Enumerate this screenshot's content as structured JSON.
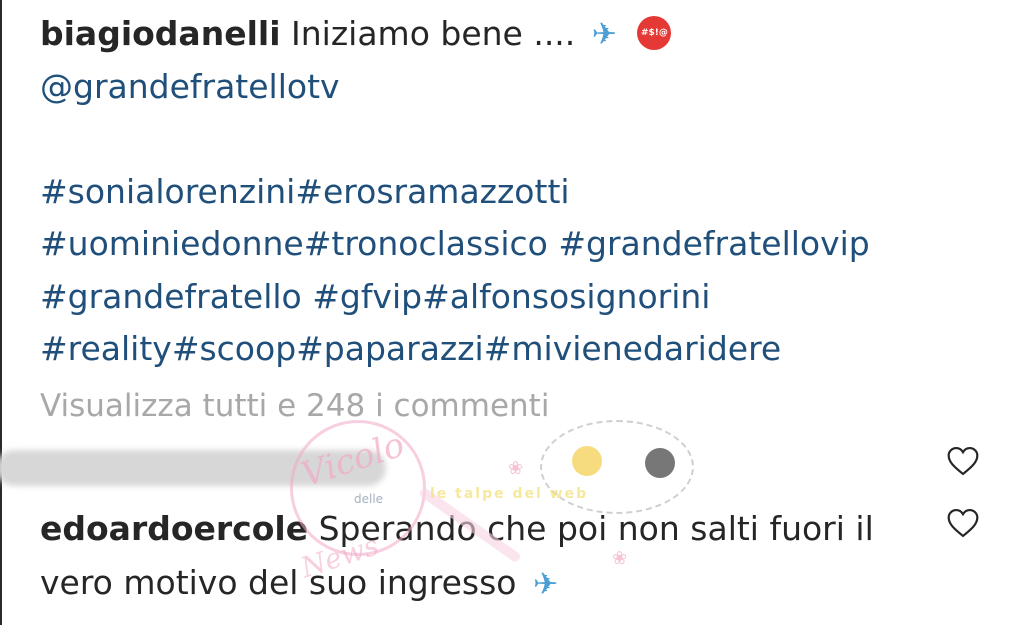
{
  "post": {
    "username": "biagiodanelli",
    "caption_text": "Iniziamo bene ....",
    "mention": "@grandefratellotv",
    "hashtag_lines": [
      "#sonialorenzini#erosramazzotti",
      "#uominiedonne#tronoclassico #grandefratellovip",
      "#grandefratello #gfvip#alfonsosignorini",
      "#reality#scoop#paparazzi#mivienedaridere"
    ],
    "emojis": [
      "airplane-icon",
      "angry-symbols-face-icon"
    ],
    "angry_face_symbols": "#$!@"
  },
  "comments": {
    "view_all_label": "Visualizza tutti e 248 i commenti",
    "items": [
      {
        "username": "edoardoercole",
        "text_line1": "Sperando che poi non salti fuori il",
        "text_line2": "vero motivo del suo ingresso"
      }
    ]
  },
  "watermark": {
    "brand_main": "Vicolo",
    "brand_small": "delle",
    "brand_bottom": "News",
    "secondary": "le talpe del web"
  },
  "colors": {
    "username": "#262626",
    "link": "#1f4f7a",
    "muted": "#a8a8a8",
    "plane": "#4b9fd5",
    "angry_face": "#e53935"
  }
}
